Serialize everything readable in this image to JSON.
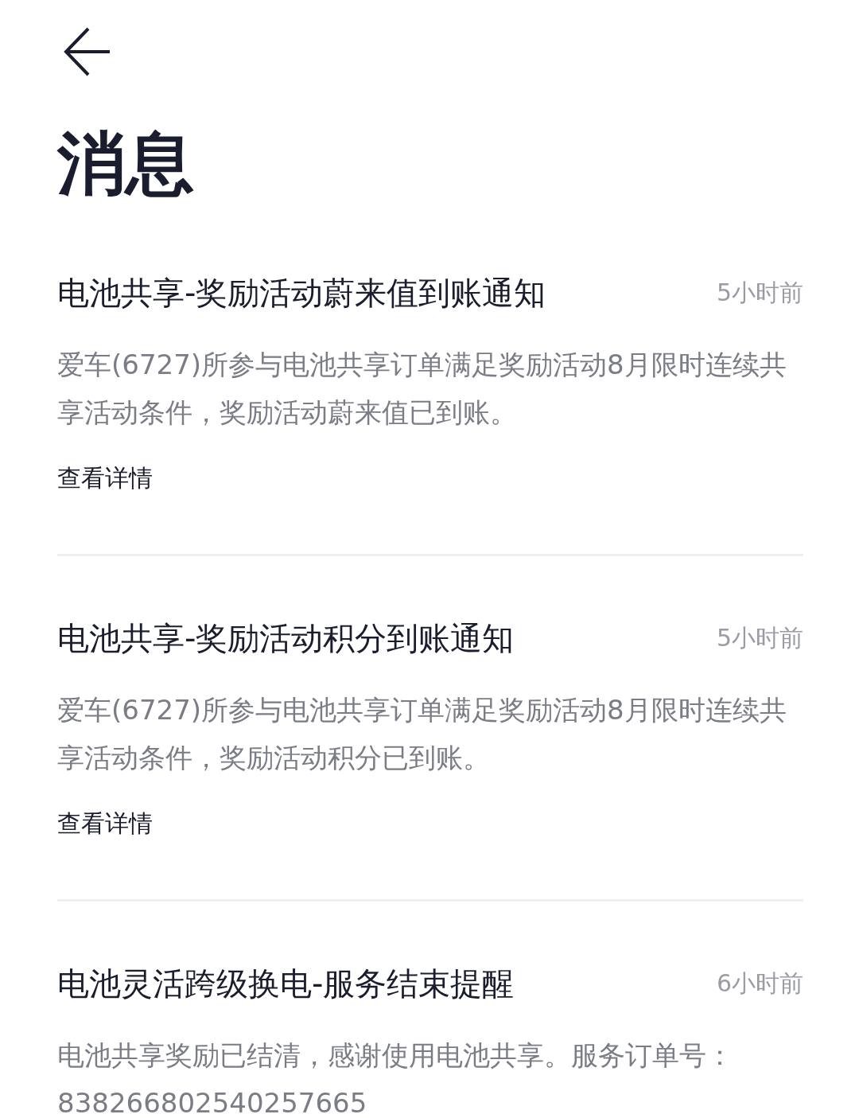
{
  "header": {
    "title": "消息"
  },
  "messages": [
    {
      "title": "电池共享-奖励活动蔚来值到账通知",
      "time": "5小时前",
      "body": "爱车(6727)所参与电池共享订单满足奖励活动8月限时连续共享活动条件，奖励活动蔚来值已到账。",
      "link": "查看详情"
    },
    {
      "title": "电池共享-奖励活动积分到账通知",
      "time": "5小时前",
      "body": "爱车(6727)所参与电池共享订单满足奖励活动8月限时连续共享活动条件，奖励活动积分已到账。",
      "link": "查看详情"
    },
    {
      "title": "电池灵活跨级换电-服务结束提醒",
      "time": "6小时前",
      "body": "电池共享奖励已结清，感谢使用电池共享。服务订单号：838266802540257665"
    }
  ]
}
